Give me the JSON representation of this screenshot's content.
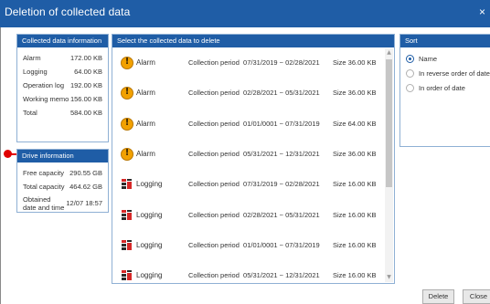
{
  "window": {
    "title": "Deletion of collected data",
    "close_glyph": "×"
  },
  "collected_info": {
    "header": "Collected data information",
    "rows": [
      {
        "label": "Alarm",
        "value": "172.00 KB"
      },
      {
        "label": "Logging",
        "value": "64.00 KB"
      },
      {
        "label": "Operation log",
        "value": "192.00 KB"
      },
      {
        "label": "Working memo",
        "value": "156.00 KB"
      },
      {
        "label": "Total",
        "value": "584.00 KB"
      }
    ]
  },
  "drive_info": {
    "header": "Drive information",
    "rows": [
      {
        "label": "Free capacity",
        "value": "290.55 GB"
      },
      {
        "label": "Total capacity",
        "value": "464.62 GB"
      },
      {
        "label": "Obtained\ndate and time",
        "value": "12/07 18:57"
      }
    ]
  },
  "data_list": {
    "header": "Select the collected data to delete",
    "period_label": "Collection period",
    "items": [
      {
        "type": "Alarm",
        "icon": "alarm-warning-icon",
        "period": "07/31/2019 ~ 02/28/2021",
        "size": "Size 36.00 KB"
      },
      {
        "type": "Alarm",
        "icon": "alarm-warning-icon",
        "period": "02/28/2021 ~ 05/31/2021",
        "size": "Size 36.00 KB"
      },
      {
        "type": "Alarm",
        "icon": "alarm-warning-icon",
        "period": "01/01/0001 ~ 07/31/2019",
        "size": "Size 64.00 KB"
      },
      {
        "type": "Alarm",
        "icon": "alarm-warning-icon",
        "period": "05/31/2021 ~ 12/31/2021",
        "size": "Size 36.00 KB"
      },
      {
        "type": "Logging",
        "icon": "logging-icon",
        "period": "07/31/2019 ~ 02/28/2021",
        "size": "Size 16.00 KB"
      },
      {
        "type": "Logging",
        "icon": "logging-icon",
        "period": "02/28/2021 ~ 05/31/2021",
        "size": "Size 16.00 KB"
      },
      {
        "type": "Logging",
        "icon": "logging-icon",
        "period": "01/01/0001 ~ 07/31/2019",
        "size": "Size 16.00 KB"
      },
      {
        "type": "Logging",
        "icon": "logging-icon",
        "period": "05/31/2021 ~ 12/31/2021",
        "size": "Size 16.00 KB"
      }
    ],
    "scrollbar": {
      "up_glyph": "▲",
      "down_glyph": "▼"
    }
  },
  "sort": {
    "header": "Sort",
    "selected": "Name",
    "options": [
      "Name",
      "In reverse order of date",
      "In order of date"
    ]
  },
  "buttons": {
    "delete": "Delete",
    "close": "Close"
  },
  "colors": {
    "title_bar": "#1f5da6",
    "panel_header": "#1f5da6",
    "alarm_icon": "#f2a100",
    "marker": "#e00000"
  }
}
